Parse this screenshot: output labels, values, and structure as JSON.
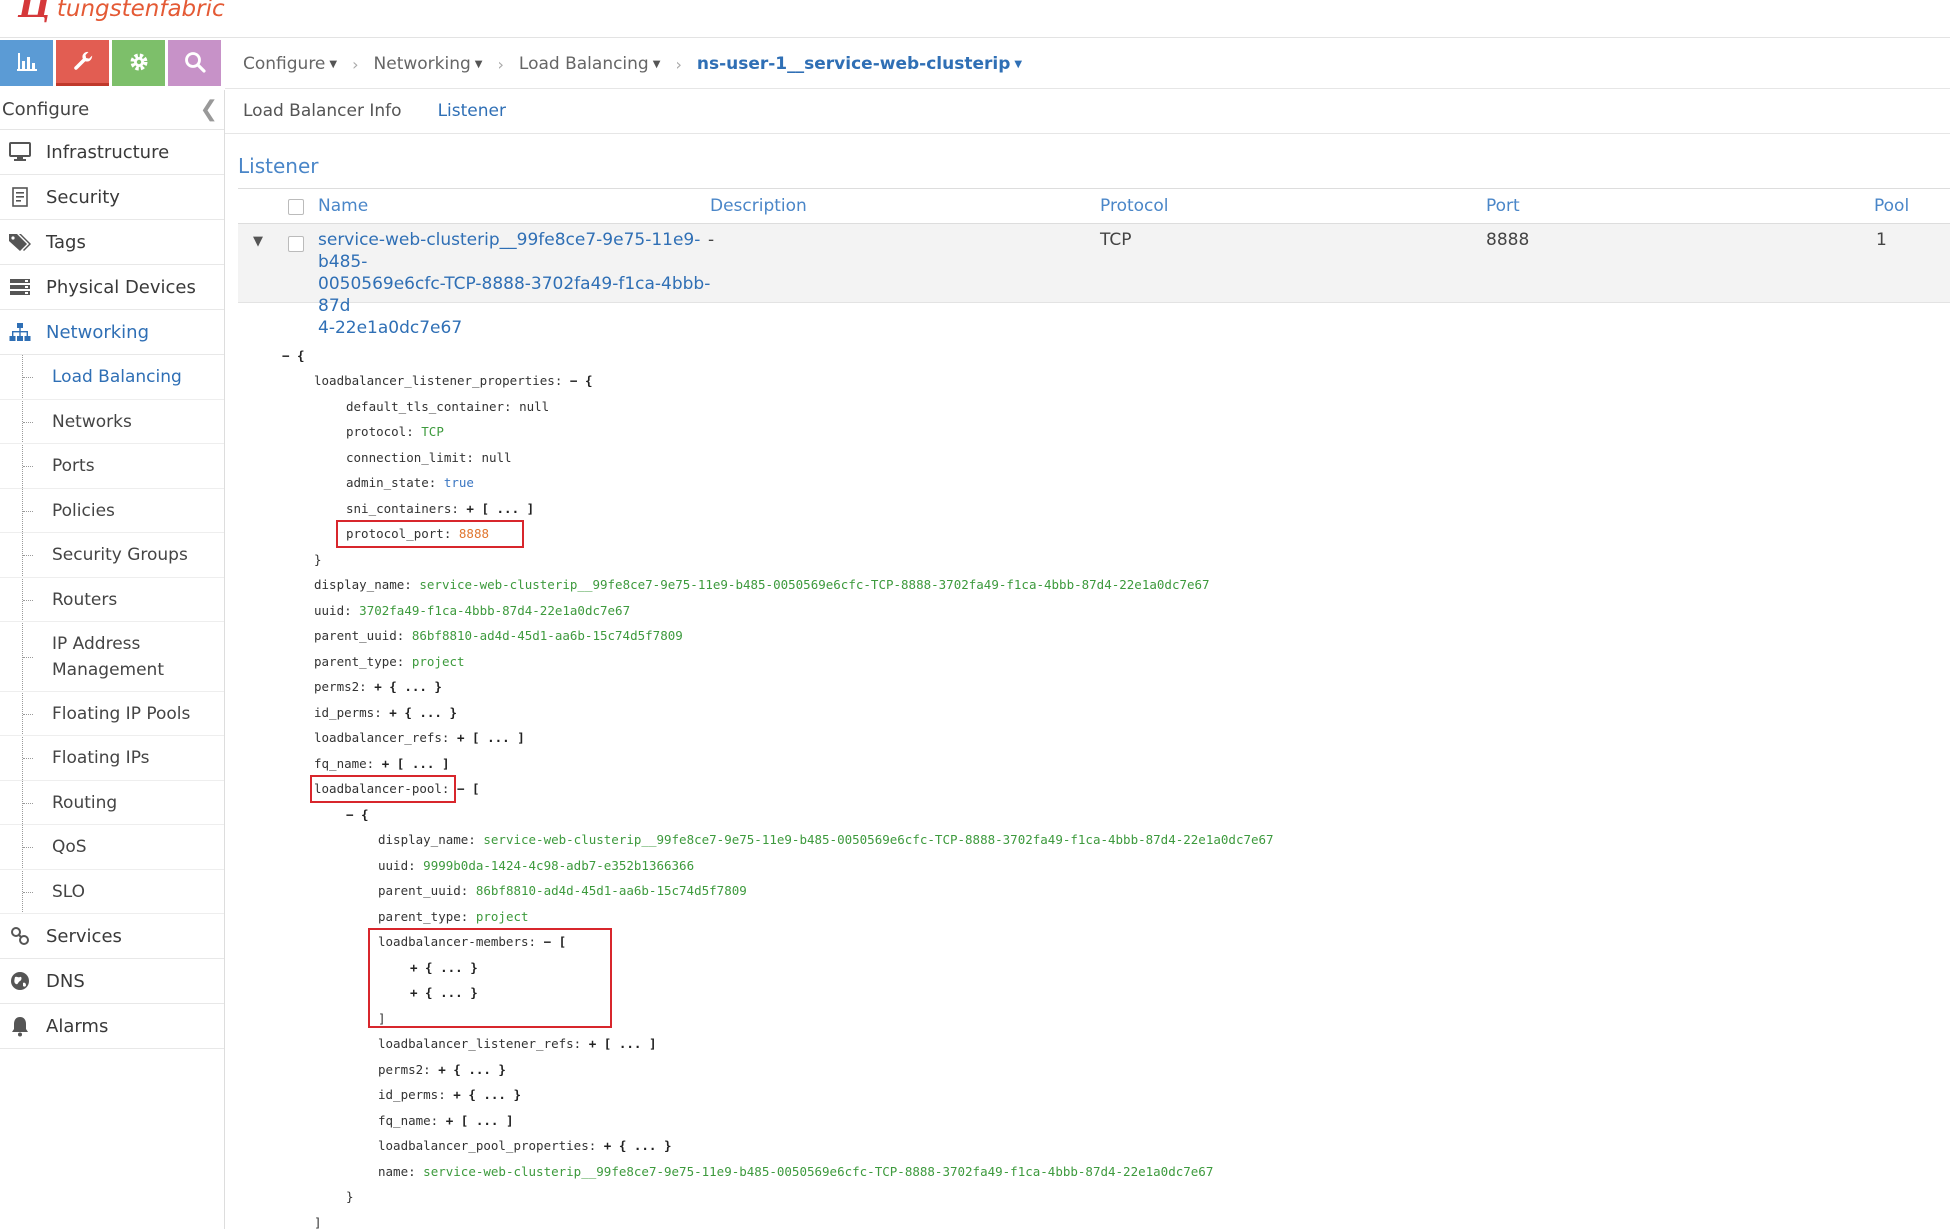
{
  "brand": {
    "mark": "Ц",
    "name": "tungstenfabric"
  },
  "icon_tabs": [
    {
      "name": "monitor-icon",
      "color": "#5b9bd5"
    },
    {
      "name": "configure-wrench-icon",
      "color": "#e25d52"
    },
    {
      "name": "settings-gear-icon",
      "color": "#7dbf6a"
    },
    {
      "name": "search-icon",
      "color": "#c792c8"
    }
  ],
  "sidebar": {
    "header": "Configure",
    "items": [
      {
        "label": "Infrastructure",
        "icon": "monitor-icon"
      },
      {
        "label": "Security",
        "icon": "security-doc-icon"
      },
      {
        "label": "Tags",
        "icon": "tags-icon"
      },
      {
        "label": "Physical Devices",
        "icon": "server-icon"
      },
      {
        "label": "Networking",
        "icon": "sitemap-icon"
      }
    ],
    "networking_children": [
      "Load Balancing",
      "Networks",
      "Ports",
      "Policies",
      "Security Groups",
      "Routers",
      "IP Address Management",
      "Floating IP Pools",
      "Floating IPs",
      "Routing",
      "QoS",
      "SLO"
    ],
    "bottom_items": [
      {
        "label": "Services",
        "icon": "link-icon"
      },
      {
        "label": "DNS",
        "icon": "globe-icon"
      },
      {
        "label": "Alarms",
        "icon": "bell-icon"
      }
    ]
  },
  "breadcrumb": {
    "items": [
      "Configure",
      "Networking",
      "Load Balancing"
    ],
    "current": "ns-user-1__service-web-clusterip"
  },
  "subtabs": [
    "Load Balancer Info",
    "Listener"
  ],
  "section_title": "Listener",
  "table": {
    "columns": [
      "Name",
      "Description",
      "Protocol",
      "Port",
      "Pool"
    ],
    "rows": [
      {
        "name_lines": [
          "service-web-clusterip__99fe8ce7-9e75-11e9-b485-",
          "0050569e6cfc-TCP-8888-3702fa49-f1ca-4bbb-87d",
          "4-22e1a0dc7e67"
        ],
        "description": "-",
        "protocol": "TCP",
        "port": "8888",
        "pool": "1"
      }
    ]
  },
  "json_tree": {
    "root_open": "− {",
    "listener_props_key": "loadbalancer_listener_properties:",
    "listener_props_open": "− {",
    "default_tls_container": {
      "k": "default_tls_container:",
      "v": "null"
    },
    "protocol": {
      "k": "protocol:",
      "v": "TCP"
    },
    "connection_limit": {
      "k": "connection_limit:",
      "v": "null"
    },
    "admin_state": {
      "k": "admin_state:",
      "v": "true"
    },
    "sni_containers": {
      "k": "sni_containers:",
      "v": "+ [ ... ]"
    },
    "protocol_port": {
      "k": "protocol_port:",
      "v": "8888"
    },
    "close_brace": "}",
    "display_name": {
      "k": "display_name:",
      "v": "service-web-clusterip__99fe8ce7-9e75-11e9-b485-0050569e6cfc-TCP-8888-3702fa49-f1ca-4bbb-87d4-22e1a0dc7e67"
    },
    "uuid": {
      "k": "uuid:",
      "v": "3702fa49-f1ca-4bbb-87d4-22e1a0dc7e67"
    },
    "parent_uuid": {
      "k": "parent_uuid:",
      "v": "86bf8810-ad4d-45d1-aa6b-15c74d5f7809"
    },
    "parent_type": {
      "k": "parent_type:",
      "v": "project"
    },
    "perms2": {
      "k": "perms2:",
      "v": "+ { ... }"
    },
    "id_perms": {
      "k": "id_perms:",
      "v": "+ { ... }"
    },
    "loadbalancer_refs": {
      "k": "loadbalancer_refs:",
      "v": "+ [ ... ]"
    },
    "fq_name": {
      "k": "fq_name:",
      "v": "+ [ ... ]"
    },
    "loadbalancer_pool": {
      "k": "loadbalancer-pool:",
      "v": "− ["
    },
    "pool_item_open": "− {",
    "pool": {
      "display_name": {
        "k": "display_name:",
        "v": "service-web-clusterip__99fe8ce7-9e75-11e9-b485-0050569e6cfc-TCP-8888-3702fa49-f1ca-4bbb-87d4-22e1a0dc7e67"
      },
      "uuid": {
        "k": "uuid:",
        "v": "9999b0da-1424-4c98-adb7-e352b1366366"
      },
      "parent_uuid": {
        "k": "parent_uuid:",
        "v": "86bf8810-ad4d-45d1-aa6b-15c74d5f7809"
      },
      "parent_type": {
        "k": "parent_type:",
        "v": "project"
      },
      "members": {
        "k": "loadbalancer-members:",
        "v": "− ["
      },
      "member1": "+ { ... }",
      "member2": "+ { ... }",
      "members_close": "]",
      "listener_refs": {
        "k": "loadbalancer_listener_refs:",
        "v": "+ [ ... ]"
      },
      "perms2": {
        "k": "perms2:",
        "v": "+ { ... }"
      },
      "id_perms": {
        "k": "id_perms:",
        "v": "+ { ... }"
      },
      "fq_name": {
        "k": "fq_name:",
        "v": "+ [ ... ]"
      },
      "pool_properties": {
        "k": "loadbalancer_pool_properties:",
        "v": "+ { ... }"
      },
      "name": {
        "k": "name:",
        "v": "service-web-clusterip__99fe8ce7-9e75-11e9-b485-0050569e6cfc-TCP-8888-3702fa49-f1ca-4bbb-87d4-22e1a0dc7e67"
      }
    },
    "pool_item_close": "}",
    "pool_close": "]"
  },
  "colors": {
    "link": "#2f6fb5",
    "highlight": "#d8262c",
    "json_string": "#3d9a3d",
    "json_number": "#e0762f"
  }
}
